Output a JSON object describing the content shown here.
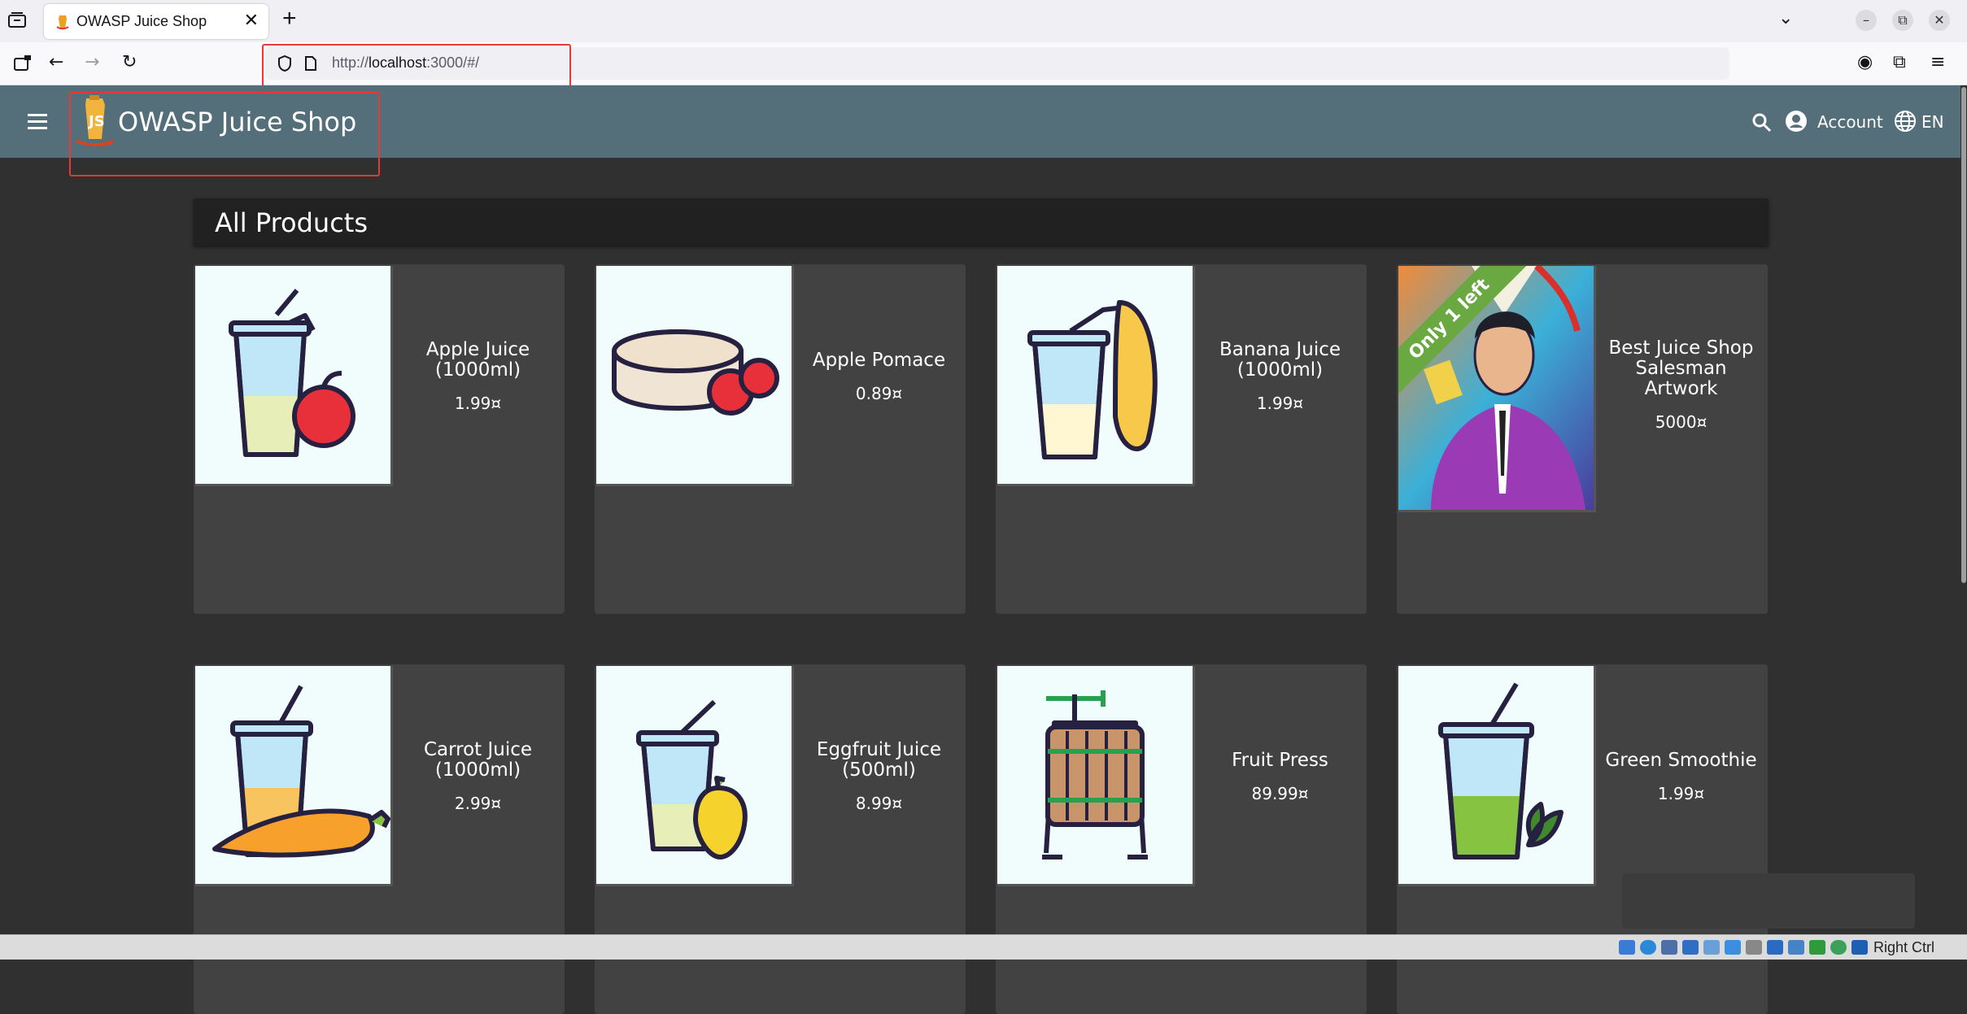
{
  "browser": {
    "tab_title": "OWASP Juice Shop",
    "tab_close": "✕",
    "new_tab": "+",
    "url_prefix": "http://",
    "url_host": "localhost",
    "url_rest": ":3000/#/"
  },
  "app": {
    "title": "OWASP Juice Shop",
    "account_label": "Account",
    "language_label": "EN"
  },
  "main": {
    "heading": "All Products",
    "products": [
      {
        "name": "Apple Juice (1000ml)",
        "price": "1.99¤",
        "image": "apple-juice"
      },
      {
        "name": "Apple Pomace",
        "price": "0.89¤",
        "image": "apple-pomace"
      },
      {
        "name": "Banana Juice (1000ml)",
        "price": "1.99¤",
        "image": "banana-juice"
      },
      {
        "name": "Best Juice Shop Salesman Artwork",
        "price": "5000¤",
        "image": "salesman-artwork",
        "badge": "Only 1 left"
      },
      {
        "name": "Carrot Juice (1000ml)",
        "price": "2.99¤",
        "image": "carrot-juice"
      },
      {
        "name": "Eggfruit Juice (500ml)",
        "price": "8.99¤",
        "image": "eggfruit-juice"
      },
      {
        "name": "Fruit Press",
        "price": "89.99¤",
        "image": "fruit-press"
      },
      {
        "name": "Green Smoothie",
        "price": "1.99¤",
        "image": "green-smoothie"
      }
    ]
  },
  "status_bar": {
    "host_key": "Right Ctrl"
  },
  "colors": {
    "toolbar": "#546e7a",
    "background": "#303030",
    "card": "#424242",
    "badge": "#6aa842",
    "highlight": "#e53935"
  }
}
